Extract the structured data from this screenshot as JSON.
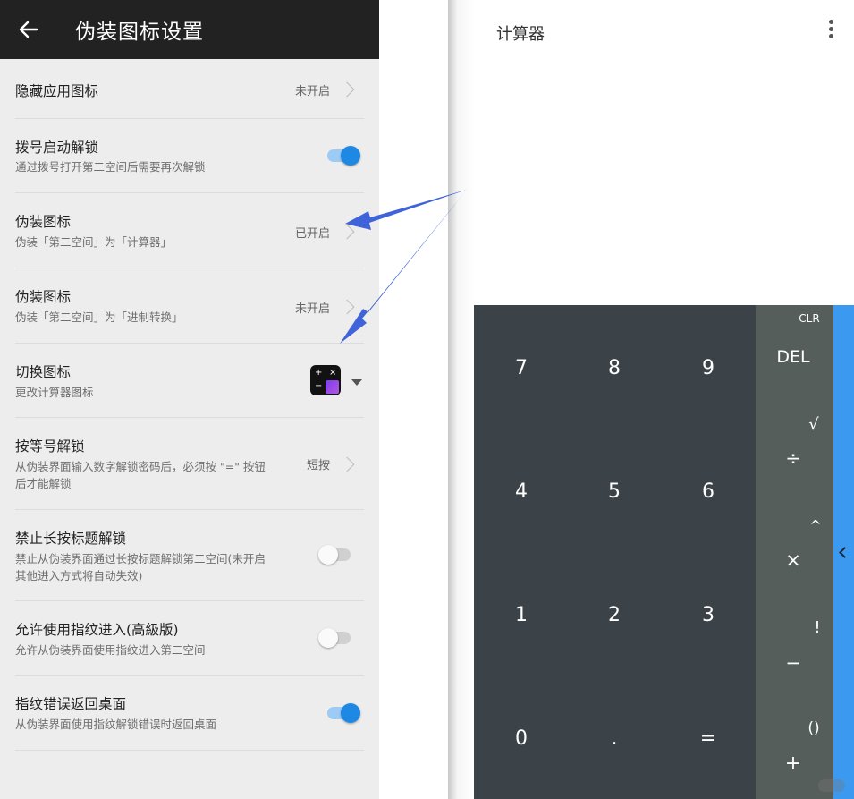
{
  "settings": {
    "header": {
      "title": "伪装图标设置"
    },
    "rows": [
      {
        "title": "隐藏应用图标",
        "status": "未开启"
      },
      {
        "title": "拨号启动解锁",
        "subtitle": "通过拨号打开第二空间后需要再次解锁",
        "toggle": "on"
      },
      {
        "title": "伪装图标",
        "subtitle": "伪装「第二空间」为「计算器」",
        "status": "已开启"
      },
      {
        "title": "伪装图标",
        "subtitle": "伪装「第二空间」为「进制转换」",
        "status": "未开启"
      },
      {
        "title": "切换图标",
        "subtitle": "更改计算器图标"
      },
      {
        "title": "按等号解锁",
        "subtitle1": "从伪装界面输入数字解锁密码后，必须按 \"=\" 按钮",
        "subtitle2": "后才能解锁",
        "status": "短按"
      },
      {
        "title": "禁止长按标题解锁",
        "subtitle1": "禁止从伪装界面通过长按标题解锁第二空间(未开启",
        "subtitle2": "其他进入方式将自动失效)",
        "toggle": "off"
      },
      {
        "title": "允许使用指纹进入(高級版)",
        "subtitle": "允许从伪装界面使用指纹进入第二空间",
        "toggle": "off"
      },
      {
        "title": "指纹错误返回桌面",
        "subtitle": "从伪装界面使用指纹解锁错误时返回桌面",
        "toggle": "on"
      }
    ],
    "icon_glyphs": {
      "plus": "+",
      "times": "×",
      "minus": "−"
    }
  },
  "calculator": {
    "title": "计算器",
    "digits": [
      "7",
      "8",
      "9",
      "4",
      "5",
      "6",
      "1",
      "2",
      "3",
      "0",
      ".",
      "="
    ],
    "ops": {
      "clr": "CLR",
      "del": "DEL",
      "sqrt": "√",
      "div": "÷",
      "pow": "^",
      "mul": "×",
      "fact": "!",
      "minus": "−",
      "paren": "()",
      "plus": "+"
    }
  },
  "colors": {
    "accent": "#1e88e5",
    "arrow": "#3f63d8",
    "appbar": "#222222",
    "pad": "#3b4349",
    "ops": "#565e5c",
    "edge": "#3b99f0"
  }
}
